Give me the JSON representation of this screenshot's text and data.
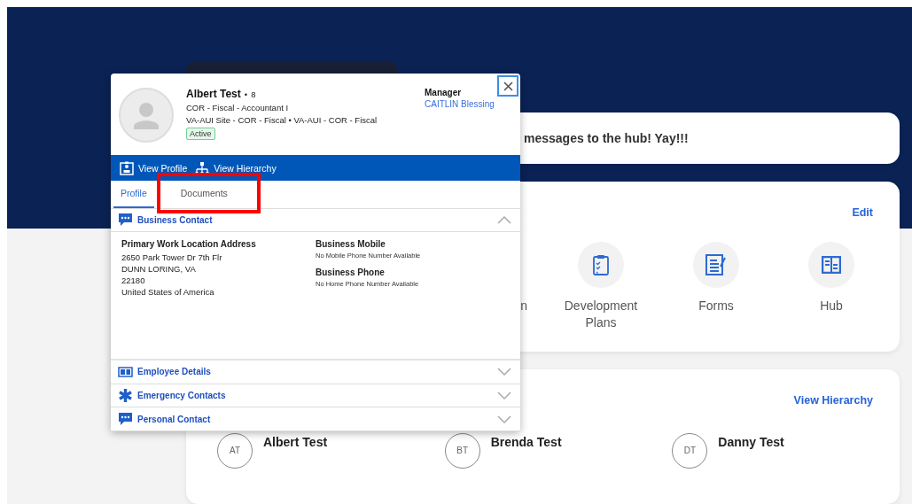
{
  "message_card": {
    "text": "messages to the hub!  Yay!!!"
  },
  "quick_links": {
    "action": "Edit",
    "items": [
      {
        "kind": "partial",
        "label": "n"
      },
      {
        "kind": "clipboard",
        "label": "Development Plans"
      },
      {
        "kind": "forms",
        "label": "Forms"
      },
      {
        "kind": "board",
        "label": "Hub"
      }
    ]
  },
  "team": {
    "action": "View Hierarchy",
    "people": [
      {
        "initials": "AT",
        "name": "Albert Test"
      },
      {
        "initials": "BT",
        "name": "Brenda Test"
      },
      {
        "initials": "DT",
        "name": "Danny Test"
      }
    ]
  },
  "popup": {
    "name": "Albert Test",
    "separator": "•",
    "count": "8",
    "job": "COR - Fiscal - Accountant I",
    "location": "VA-AUI Site - COR - Fiscal  •  VA-AUI - COR - Fiscal",
    "status": "Active",
    "manager_label": "Manager",
    "manager": "CAITLIN Blessing",
    "actions": [
      "View Profile",
      "View Hierarchy"
    ],
    "tabs": [
      {
        "label": "Profile",
        "selected": true
      },
      {
        "label": "Documents",
        "selected": false
      }
    ],
    "sections": [
      {
        "title": "Business Contact",
        "kind": "chat",
        "expanded": true,
        "address_label": "Primary Work Location Address",
        "address_lines": [
          "2650 Park Tower Dr 7th Flr",
          "DUNN LORING, VA",
          "22180",
          "United States of America"
        ],
        "phones": [
          {
            "label": "Business Mobile",
            "value": "No Mobile Phone Number Available"
          },
          {
            "label": "Business Phone",
            "value": "No Home Phone Number Available"
          }
        ]
      },
      {
        "title": "Employee Details",
        "kind": "card",
        "expanded": false
      },
      {
        "title": "Emergency Contacts",
        "kind": "asterisk",
        "expanded": false
      },
      {
        "title": "Personal Contact",
        "kind": "chat",
        "expanded": false
      }
    ]
  }
}
